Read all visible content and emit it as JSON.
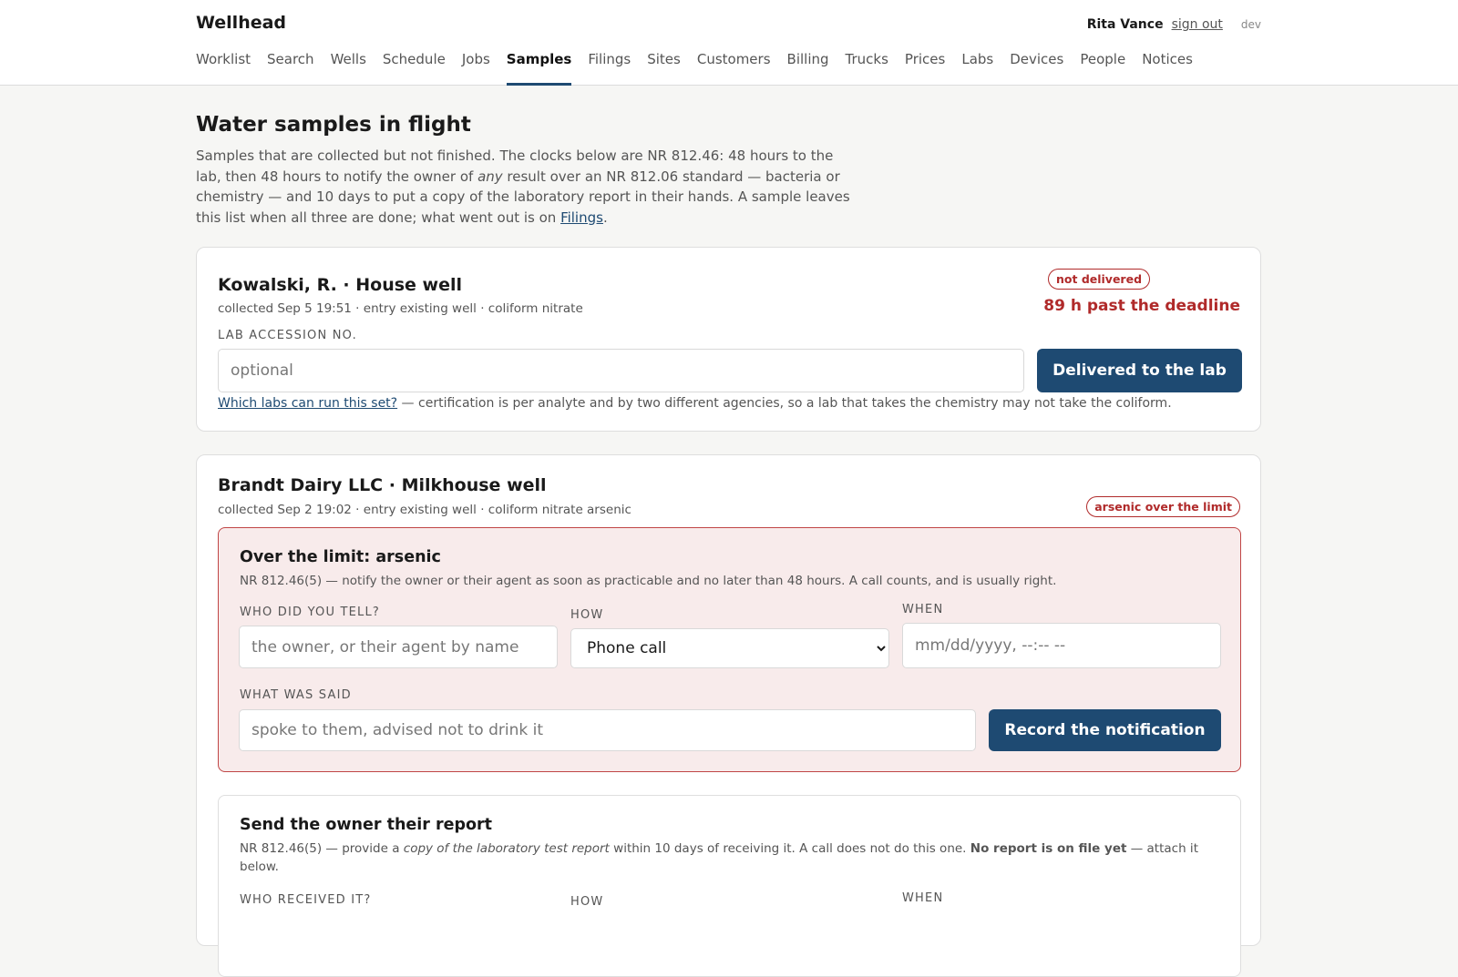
{
  "app": {
    "brand": "Wellhead",
    "user_name": "Rita Vance",
    "sign_out": "sign out",
    "env": "dev"
  },
  "nav": [
    {
      "label": "Worklist"
    },
    {
      "label": "Search"
    },
    {
      "label": "Wells"
    },
    {
      "label": "Schedule"
    },
    {
      "label": "Jobs"
    },
    {
      "label": "Samples",
      "active": true
    },
    {
      "label": "Filings"
    },
    {
      "label": "Sites"
    },
    {
      "label": "Customers"
    },
    {
      "label": "Billing"
    },
    {
      "label": "Trucks"
    },
    {
      "label": "Prices"
    },
    {
      "label": "Labs"
    },
    {
      "label": "Devices"
    },
    {
      "label": "People"
    },
    {
      "label": "Notices"
    }
  ],
  "page": {
    "title": "Water samples in flight",
    "intro_part1": "Samples that are collected but not finished. The clocks below are NR 812.46: 48 hours to the lab, then 48 hours to notify the owner of ",
    "intro_em": "any",
    "intro_part2": " result over an NR 812.06 standard — bacteria or chemistry — and 10 days to put a copy of the laboratory report in their hands. A sample leaves this list when all three are done; what went out is on ",
    "intro_link": "Filings",
    "intro_end": "."
  },
  "samples": [
    {
      "title": "Kowalski, R. · House well",
      "meta": "collected Sep 5 19:51 · entry existing well · coliform nitrate",
      "badge": "not delivered",
      "deadline": "89 h past the deadline",
      "accession_label": "Lab accession no.",
      "accession_placeholder": "optional",
      "accession_value": "",
      "deliver_button": "Delivered to the lab",
      "labs_link": "Which labs can run this set?",
      "labs_note": " — certification is per analyte and by two different agencies, so a lab that takes the chemistry may not take the coliform."
    },
    {
      "title": "Brandt Dairy LLC · Milkhouse well",
      "meta": "collected Sep 2 19:02 · entry existing well · coliform nitrate arsenic",
      "badge": "arsenic over the limit",
      "alert": {
        "title": "Over the limit: arsenic",
        "note": "NR 812.46(5) — notify the owner or their agent as soon as practicable and no later than 48 hours. A call counts, and is usually right.",
        "who_label": "Who did you tell?",
        "who_placeholder": "the owner, or their agent by name",
        "how_label": "How",
        "how_value": "Phone call",
        "when_label": "When",
        "when_placeholder": "mm/dd/yyyy, --:-- --",
        "said_label": "What was said",
        "said_placeholder": "spoke to them, advised not to drink it",
        "record_button": "Record the notification"
      },
      "report": {
        "title": "Send the owner their report",
        "note_part1": "NR 812.46(5) — provide a ",
        "note_em": "copy of the laboratory test report",
        "note_part2": " within 10 days of receiving it. A call does not do this one. ",
        "note_strong": "No report is on file yet",
        "note_part3": " — attach it below.",
        "who_label": "Who received it?",
        "how_label": "How",
        "when_label": "When"
      }
    }
  ],
  "colors": {
    "accent": "#1e4a72",
    "danger": "#b02a2a",
    "alert_bg": "#f8ebeb"
  }
}
